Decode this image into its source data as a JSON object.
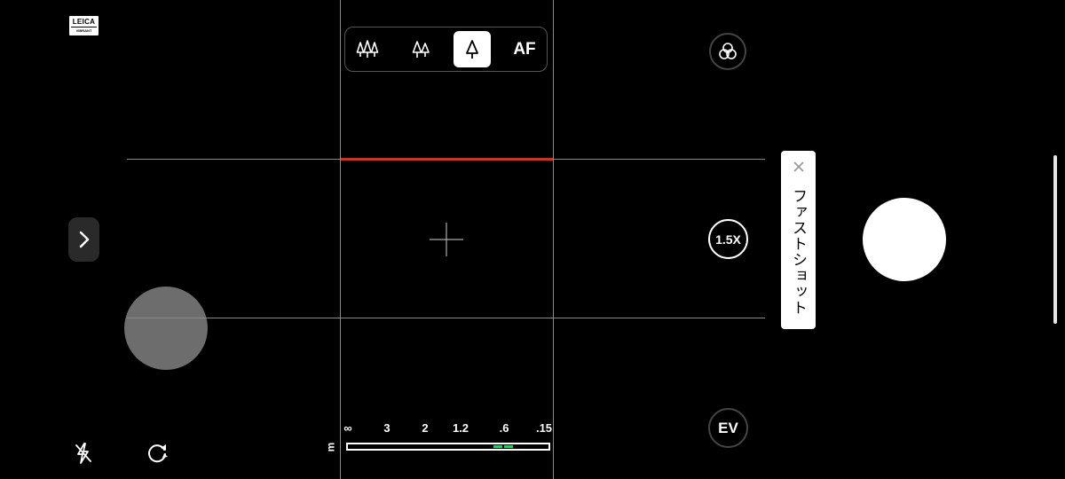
{
  "badge": {
    "brand": "LEICA",
    "mode": "VIBRANT"
  },
  "focus_modes": {
    "items": [
      {
        "name": "landscape-focus",
        "icon": "three-trees-icon"
      },
      {
        "name": "group-focus",
        "icon": "two-trees-icon"
      },
      {
        "name": "single-focus",
        "icon": "single-tree-icon",
        "selected": true
      },
      {
        "name": "auto-focus",
        "label": "AF"
      }
    ]
  },
  "distance_scale": {
    "labels": [
      "∞",
      "3",
      "2",
      "1.2",
      ".6",
      ".15"
    ],
    "unit": "m",
    "focus_marker_color": "#33c46a"
  },
  "zoom": {
    "label": "1.5X"
  },
  "exposure": {
    "label": "EV"
  },
  "fast_shot": {
    "label": "ファストショット"
  },
  "colors": {
    "level_line": "#c9342a",
    "grid": "#8a8a8a"
  }
}
